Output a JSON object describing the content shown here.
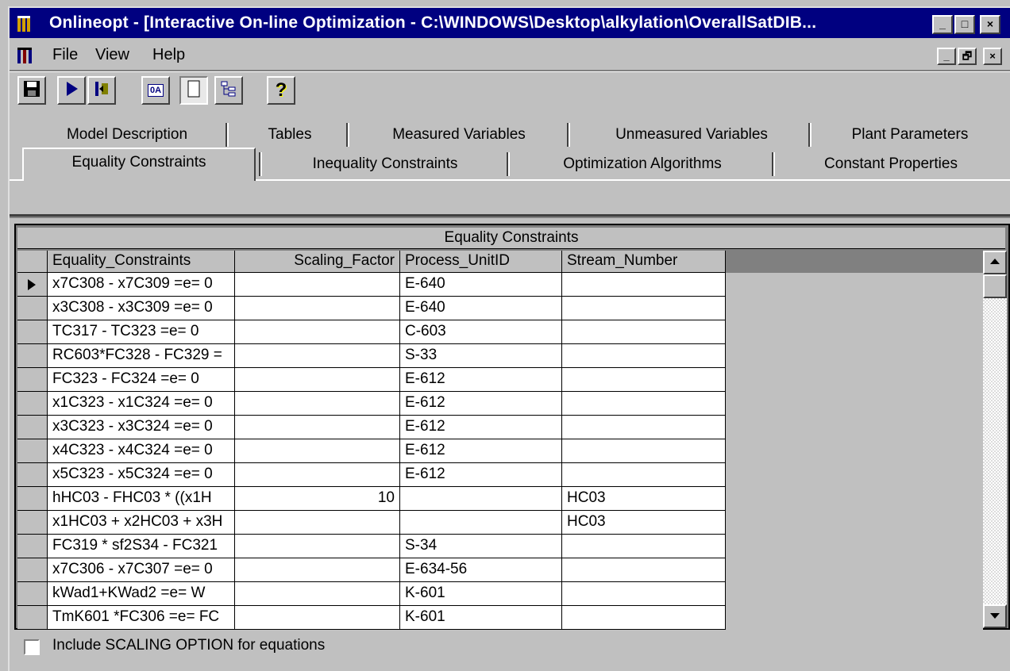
{
  "window": {
    "title": "Onlineopt - [Interactive On-line Optimization - C:\\WINDOWS\\Desktop\\alkylation\\OverallSatDIB...",
    "controls": [
      "_",
      "□",
      "×"
    ]
  },
  "menu": {
    "items": [
      {
        "label": "File"
      },
      {
        "label": "View"
      },
      {
        "label": "Help"
      }
    ],
    "mdi_controls": [
      "_",
      "🗗",
      "×"
    ]
  },
  "toolbar": {
    "buttons": [
      {
        "icon": "save-icon"
      },
      {
        "icon": "play-icon"
      },
      {
        "icon": "step-icon"
      },
      {
        "icon": "oa-icon",
        "text": "0A"
      },
      {
        "icon": "blank-page-icon"
      },
      {
        "icon": "tree-icon"
      },
      {
        "icon": "help-icon",
        "text": "?"
      }
    ]
  },
  "tabs": {
    "row1": [
      "Model Description",
      "Tables",
      "Measured Variables",
      "Unmeasured Variables",
      "Plant Parameters"
    ],
    "row2": [
      "Equality Constraints",
      "Inequality Constraints",
      "Optimization Algorithms",
      "Constant Properties"
    ],
    "active": "Equality Constraints"
  },
  "grid": {
    "title": "Equality Constraints",
    "columns": [
      "Equality_Constraints",
      "Scaling_Factor",
      "Process_UnitID",
      "Stream_Number"
    ],
    "rows": [
      [
        "x7C308 - x7C309 =e= 0",
        "",
        "E-640",
        ""
      ],
      [
        "x3C308 - x3C309 =e= 0",
        "",
        "E-640",
        ""
      ],
      [
        "TC317 - TC323 =e= 0",
        "",
        "C-603",
        ""
      ],
      [
        "RC603*FC328 - FC329 =",
        "",
        "S-33",
        ""
      ],
      [
        "FC323 - FC324 =e= 0",
        "",
        "E-612",
        ""
      ],
      [
        "x1C323 - x1C324 =e= 0",
        "",
        "E-612",
        ""
      ],
      [
        "x3C323 - x3C324 =e= 0",
        "",
        "E-612",
        ""
      ],
      [
        "x4C323 - x4C324 =e= 0",
        "",
        "E-612",
        ""
      ],
      [
        "x5C323 - x5C324 =e= 0",
        "",
        "E-612",
        ""
      ],
      [
        "hHC03 -  FHC03 *  ((x1H",
        "10",
        "",
        "HC03"
      ],
      [
        "x1HC03 + x2HC03 + x3H",
        "",
        "",
        "HC03"
      ],
      [
        "FC319 * sf2S34 - FC321",
        "",
        "S-34",
        ""
      ],
      [
        "x7C306 - x7C307 =e= 0",
        "",
        "E-634-56",
        ""
      ],
      [
        "kWad1+KWad2 =e= W",
        "",
        "K-601",
        ""
      ],
      [
        "TmK601 *FC306 =e= FC",
        "",
        "K-601",
        ""
      ]
    ]
  },
  "checkbox": {
    "label": "Include SCALING OPTION for equations",
    "checked": false
  }
}
